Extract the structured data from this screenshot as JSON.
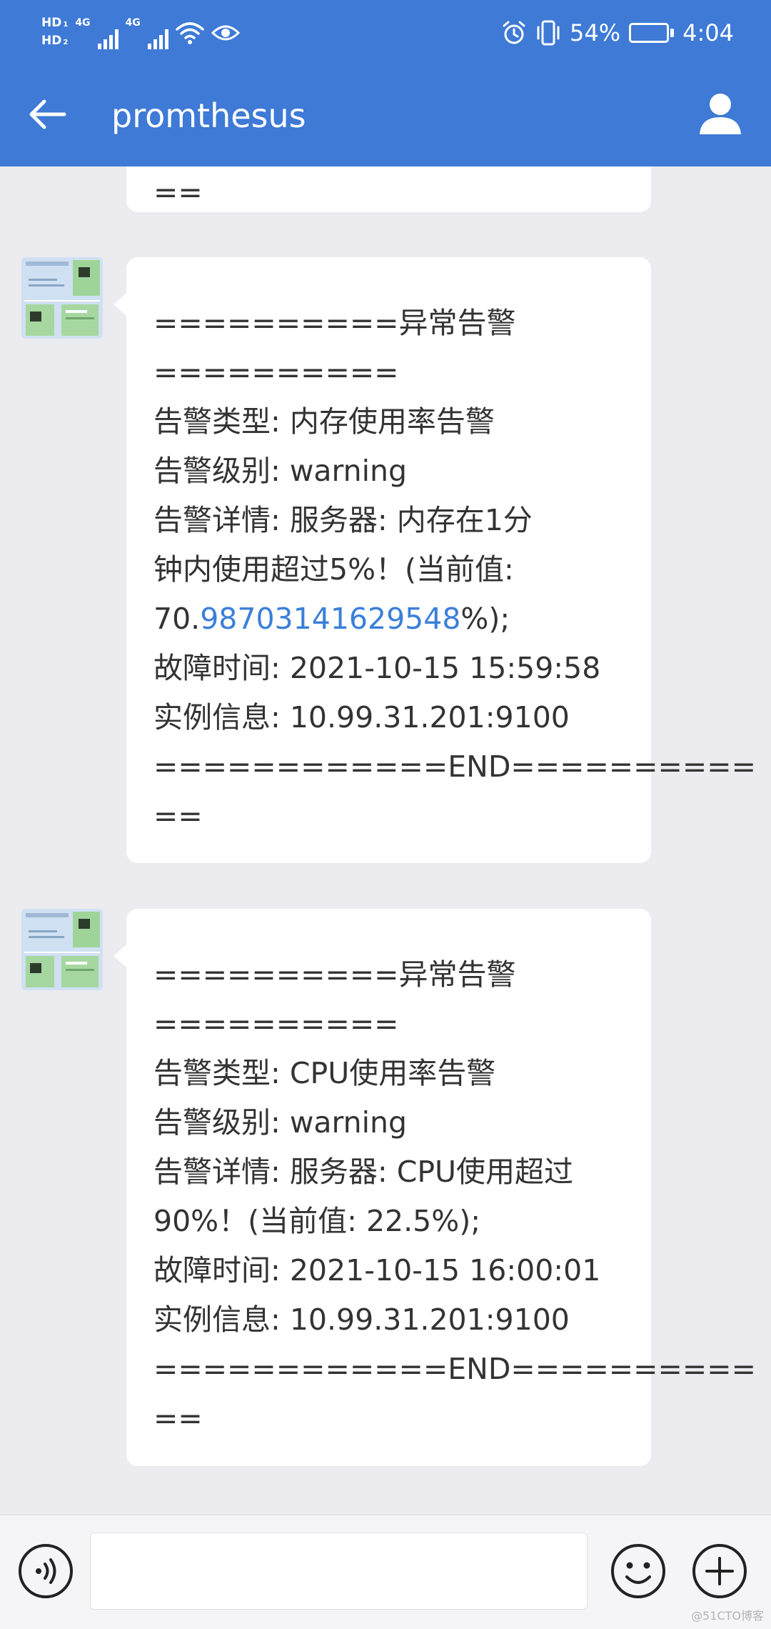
{
  "status_bar": {
    "hd_1": "HD",
    "hd_1_sub": "1",
    "hd_2": "HD",
    "hd_2_sub": "2",
    "network_1": "4G",
    "network_2": "4G",
    "battery_percent": "54%",
    "battery_level": 0.54,
    "time": "4:04"
  },
  "app_bar": {
    "title": "promthesus",
    "back_icon": "arrow-left-icon",
    "profile_icon": "person-icon"
  },
  "messages": [
    {
      "lines": [
        "=="
      ]
    },
    {
      "lines": [
        "==========异常告警",
        "==========",
        "告警类型: 内存使用率告警",
        "告警级别: warning",
        "告警详情: 服务器: 内存在1分",
        "钟内使用超过5%！(当前值:",
        "70.98703141629548%);",
        "故障时间: 2021-10-15 15:59:58",
        "实例信息: 10.99.31.201:9100",
        "============END==========",
        "=="
      ],
      "link_text": "98703141629548"
    },
    {
      "lines": [
        "==========异常告警",
        "==========",
        "告警类型: CPU使用率告警",
        "告警级别: warning",
        "告警详情: 服务器: CPU使用超过",
        "90%！(当前值: 22.5%);",
        "故障时间: 2021-10-15 16:00:01",
        "实例信息: 10.99.31.201:9100",
        "============END==========",
        "=="
      ]
    }
  ],
  "input_bar": {
    "voice_icon": "voice-input-icon",
    "emoji_icon": "emoji-icon",
    "plus_icon": "plus-icon",
    "input_value": ""
  },
  "watermark": "@51CTO博客"
}
